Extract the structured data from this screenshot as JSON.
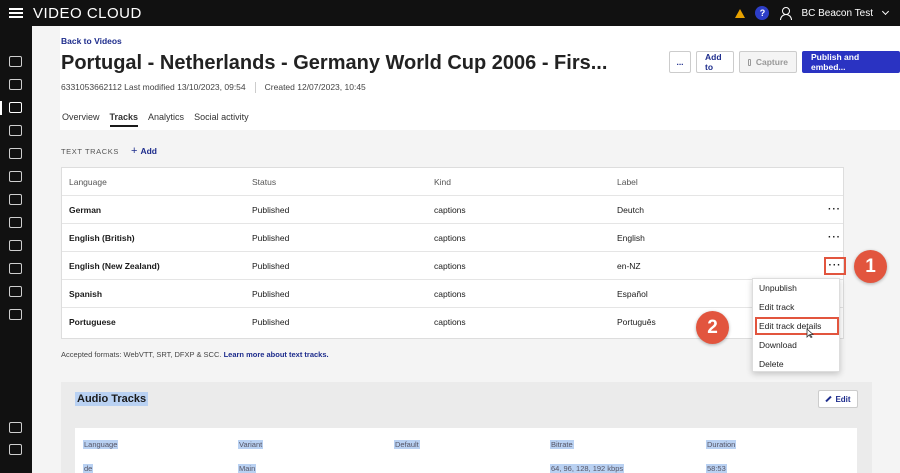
{
  "app": {
    "brand": "VIDEO CLOUD",
    "user": "BC Beacon Test",
    "help": "?"
  },
  "page": {
    "back_link": "Back to Videos",
    "title": "Portugal - Netherlands - Germany World Cup 2006 - Firs...",
    "video_id_modified": "6331053662112 Last modified 13/10/2023, 09:54",
    "created": "Created 12/07/2023, 10:45",
    "actions": {
      "more": "...",
      "add_to": "Add to",
      "capture": "Capture",
      "publish": "Publish and embed..."
    },
    "tabs": [
      {
        "label": "Overview",
        "active": false
      },
      {
        "label": "Tracks",
        "active": true
      },
      {
        "label": "Analytics",
        "active": false
      },
      {
        "label": "Social activity",
        "active": false
      }
    ]
  },
  "text_tracks": {
    "heading": "TEXT TRACKS",
    "add_label": "Add",
    "columns": [
      "Language",
      "Status",
      "Kind",
      "Label"
    ],
    "rows": [
      {
        "language": "German",
        "status": "Published",
        "kind": "captions",
        "label": "Deutch",
        "more": "···"
      },
      {
        "language": "English (British)",
        "status": "Published",
        "kind": "captions",
        "label": "English",
        "more": "···"
      },
      {
        "language": "English (New Zealand)",
        "status": "Published",
        "kind": "captions",
        "label": "en-NZ",
        "more": "···"
      },
      {
        "language": "Spanish",
        "status": "Published",
        "kind": "captions",
        "label": "Español",
        "more": ""
      },
      {
        "language": "Portuguese",
        "status": "Published",
        "kind": "captions",
        "label": "Português",
        "more": ""
      }
    ],
    "accepted_text": "Accepted formats: WebVTT, SRT, DFXP & SCC.",
    "accepted_link": "Learn more about text tracks."
  },
  "context_menu": {
    "items": [
      "Unpublish",
      "Edit track",
      "Edit track details",
      "Download",
      "Delete"
    ],
    "highlighted": "Edit track details"
  },
  "annotations": {
    "step1": "1",
    "step2": "2",
    "color": "#e2553e"
  },
  "audio_tracks": {
    "heading": "Audio Tracks",
    "edit_label": "Edit",
    "columns": [
      "Language",
      "Variant",
      "Default",
      "Bitrate",
      "Duration"
    ],
    "row": {
      "language": "de",
      "variant": "Main",
      "default": "",
      "bitrate": "64, 96, 128, 192 kbps",
      "duration": "58:53"
    }
  },
  "colors": {
    "accent": "#2a33c2",
    "link": "#1d2c8c",
    "topbar": "#111111",
    "selection": "#b9d1f2"
  }
}
